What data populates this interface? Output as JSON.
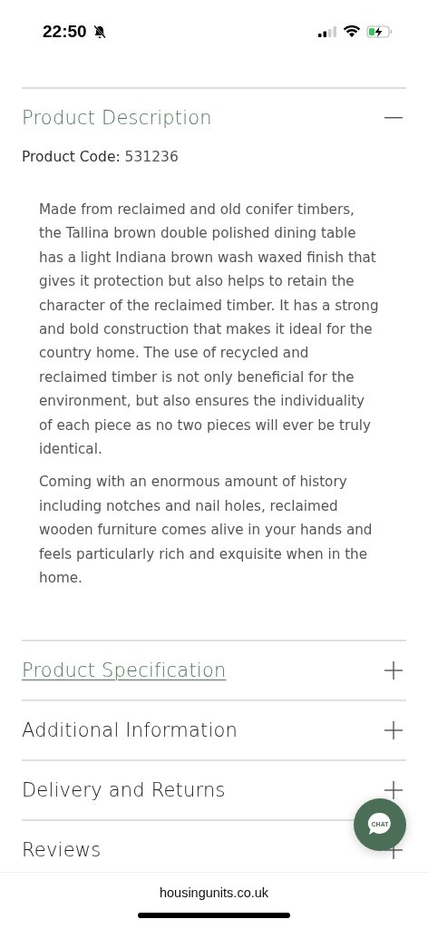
{
  "status_bar": {
    "time": "22:50"
  },
  "description": {
    "title": "Product Description",
    "expanded": true,
    "code_label": "Product Code:",
    "code": "531236",
    "paragraphs": [
      "Made from reclaimed and old conifer timbers, the Tallina brown double polished dining table has a light Indiana brown wash waxed finish that gives it protection but also helps to retain the character of the reclaimed timber. It has a strong and bold construction that makes it ideal for the country home. The use of recycled and reclaimed timber is not only beneficial for the environment, but also ensures the individuality of each piece as no two pieces will ever be truly identical.",
      "Coming with an enormous amount of history including notches and nail holes, reclaimed wooden furniture comes alive in your hands and feels particularly rich and exquisite when in the home."
    ]
  },
  "sections": [
    {
      "title": "Product Specification",
      "expanded": false,
      "kind": "link"
    },
    {
      "title": "Additional Information",
      "expanded": false,
      "kind": "plain"
    },
    {
      "title": "Delivery and Returns",
      "expanded": false,
      "kind": "plain"
    },
    {
      "title": "Reviews",
      "expanded": false,
      "kind": "plain"
    }
  ],
  "chat_button": {
    "label": "CHAT"
  },
  "browser_bar": {
    "url": "housingunits.co.uk"
  }
}
